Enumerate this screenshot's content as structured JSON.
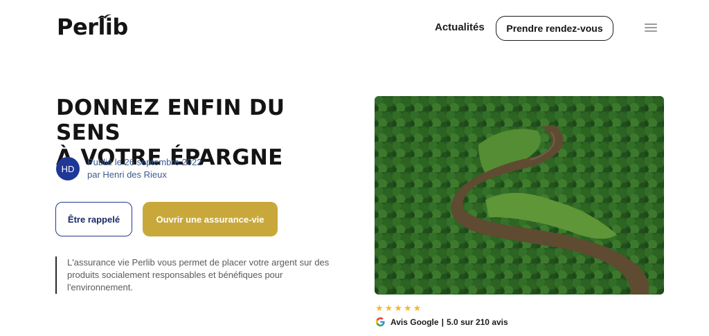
{
  "header": {
    "logo_text": "Perlib",
    "nav_link": "Actualités",
    "cta_label": "Prendre rendez-vous"
  },
  "hero": {
    "headline_line1": "DONNEZ ENFIN DU SENS",
    "headline_line2": "À VOTRE ÉPARGNE",
    "author": {
      "initials": "HD",
      "published": "Publié le 26 septembre 2022",
      "byline": "par Henri des Rieux"
    },
    "button_call": "Être rappelé",
    "button_open": "Ouvrir une assurance-vie",
    "intro": "L'assurance vie Perlib vous permet de placer votre argent sur des produits socialement responsables et bénéfiques pour l'environnement."
  },
  "reviews": {
    "rating_stars": 5,
    "source": "Avis Google",
    "score": "5.0 sur 210 avis"
  },
  "colors": {
    "accent_gold": "#c9a83b",
    "navy": "#1f3796",
    "star": "#f3b930"
  },
  "icons": [
    "logo-bird-icon",
    "menu-icon",
    "google-icon",
    "star-icon"
  ]
}
